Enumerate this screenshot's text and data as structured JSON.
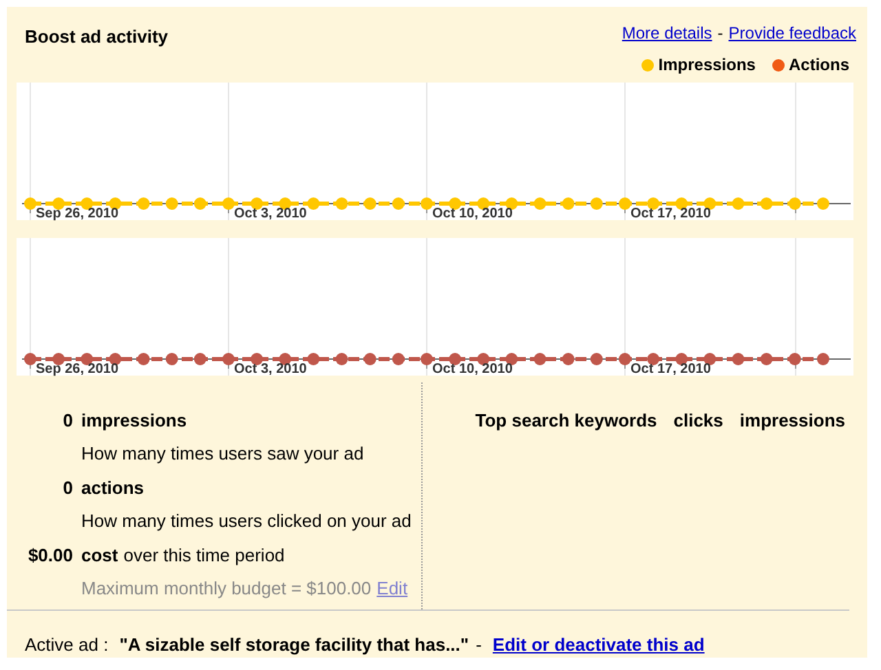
{
  "header": {
    "title": "Boost ad activity",
    "links": [
      "More details",
      "Provide feedback"
    ],
    "separator": "-"
  },
  "legend": [
    {
      "label": "Impressions",
      "color": "#ffc700"
    },
    {
      "label": "Actions",
      "color": "#f05a14"
    }
  ],
  "charts": [
    {
      "color": "#ffc700",
      "x_labels": [
        "Sep 26, 2010",
        "Oct 3, 2010",
        "Oct 10, 2010",
        "Oct 17, 2010"
      ]
    },
    {
      "color": "#c0574b",
      "x_labels": [
        "Sep 26, 2010",
        "Oct 3, 2010",
        "Oct 10, 2010",
        "Oct 17, 2010"
      ]
    }
  ],
  "stats": [
    {
      "value": "0",
      "label": "impressions",
      "description": "How many times users saw your ad"
    },
    {
      "value": "0",
      "label": "actions",
      "description": "How many times users clicked on your ad"
    },
    {
      "value": "$0.00",
      "label": "cost",
      "suffix": "over this time period",
      "description": "Maximum monthly budget = $100.00",
      "link": "Edit"
    }
  ],
  "keywords_table": {
    "columns": [
      "Top search keywords",
      "clicks",
      "impressions"
    ]
  },
  "active_ad": {
    "label": "Active ad :",
    "text": "\"A sizable self storage facility that has...\"",
    "separator": "-",
    "link": "Edit or deactivate this ad"
  }
}
